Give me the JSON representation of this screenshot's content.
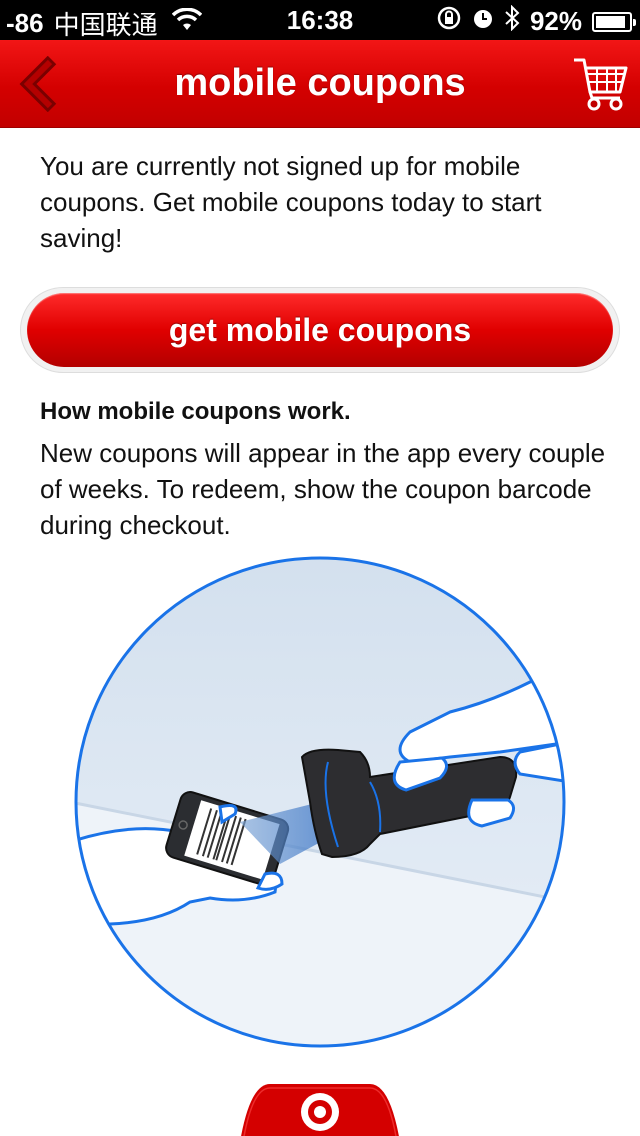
{
  "status_bar": {
    "signal": "-86",
    "carrier": "中国联通",
    "time": "16:38",
    "battery": "92%",
    "battery_level": 0.92
  },
  "nav": {
    "title": "mobile coupons"
  },
  "intro": {
    "text": "You are currently not signed up for mobile coupons. Get mobile coupons today to start saving!"
  },
  "cta": {
    "label": "get mobile coupons"
  },
  "how": {
    "heading": "How mobile coupons work.",
    "text": "New coupons will appear in the app every couple of weeks. To redeem, show the coupon barcode during checkout."
  },
  "icons": {
    "back": "chevron-left-icon",
    "cart": "shopping-cart-icon",
    "home": "target-logo-icon",
    "wifi": "wifi-icon",
    "rotation_lock": "rotation-lock-icon",
    "alarm": "alarm-icon",
    "bluetooth": "bluetooth-icon"
  },
  "colors": {
    "brand_red": "#cc0000",
    "illustration_blue": "#1a73e8"
  }
}
